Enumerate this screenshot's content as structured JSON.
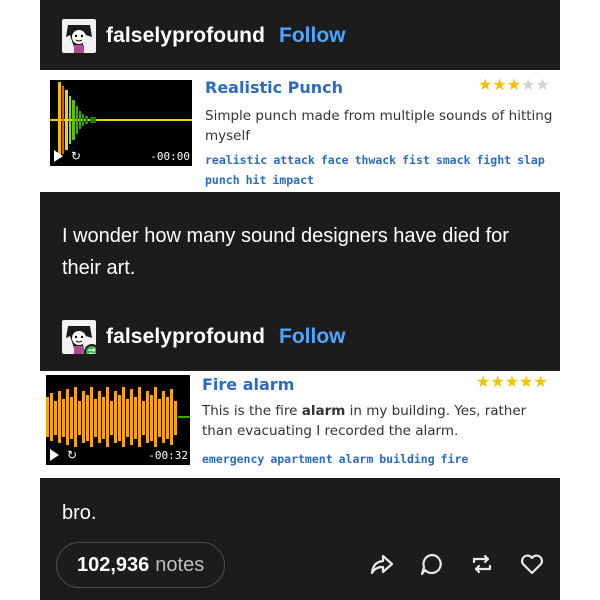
{
  "post1": {
    "username": "falselyprofound",
    "follow_label": "Follow",
    "sound": {
      "title": "Realistic Punch",
      "rating": 3.5,
      "description": "Simple punch made from multiple sounds of hitting myself",
      "duration": "-00:00",
      "tags": [
        "realistic",
        "attack",
        "face",
        "thwack",
        "fist",
        "smack",
        "fight",
        "slap",
        "punch",
        "hit",
        "impact"
      ]
    },
    "caption": "I wonder how many sound designers have died for their art."
  },
  "post2": {
    "username": "falselyprofound",
    "follow_label": "Follow",
    "sound": {
      "title": "Fire alarm",
      "rating": 5,
      "description_parts": [
        "This is the fire ",
        "alarm",
        " in my building. Yes, rather than evacuating I recorded the alarm."
      ],
      "duration": "-00:32",
      "tags": [
        "emergency",
        "apartment",
        "alarm",
        "building",
        "fire"
      ]
    },
    "caption": "bro."
  },
  "footer": {
    "notes_count": "102,936",
    "notes_label": "notes"
  },
  "colors": {
    "background": "#1c1c1c",
    "link_blue": "#4da6ff",
    "sound_title": "#2a6bc8",
    "star": "#f2c200",
    "reblog_green": "#2eb84b"
  }
}
